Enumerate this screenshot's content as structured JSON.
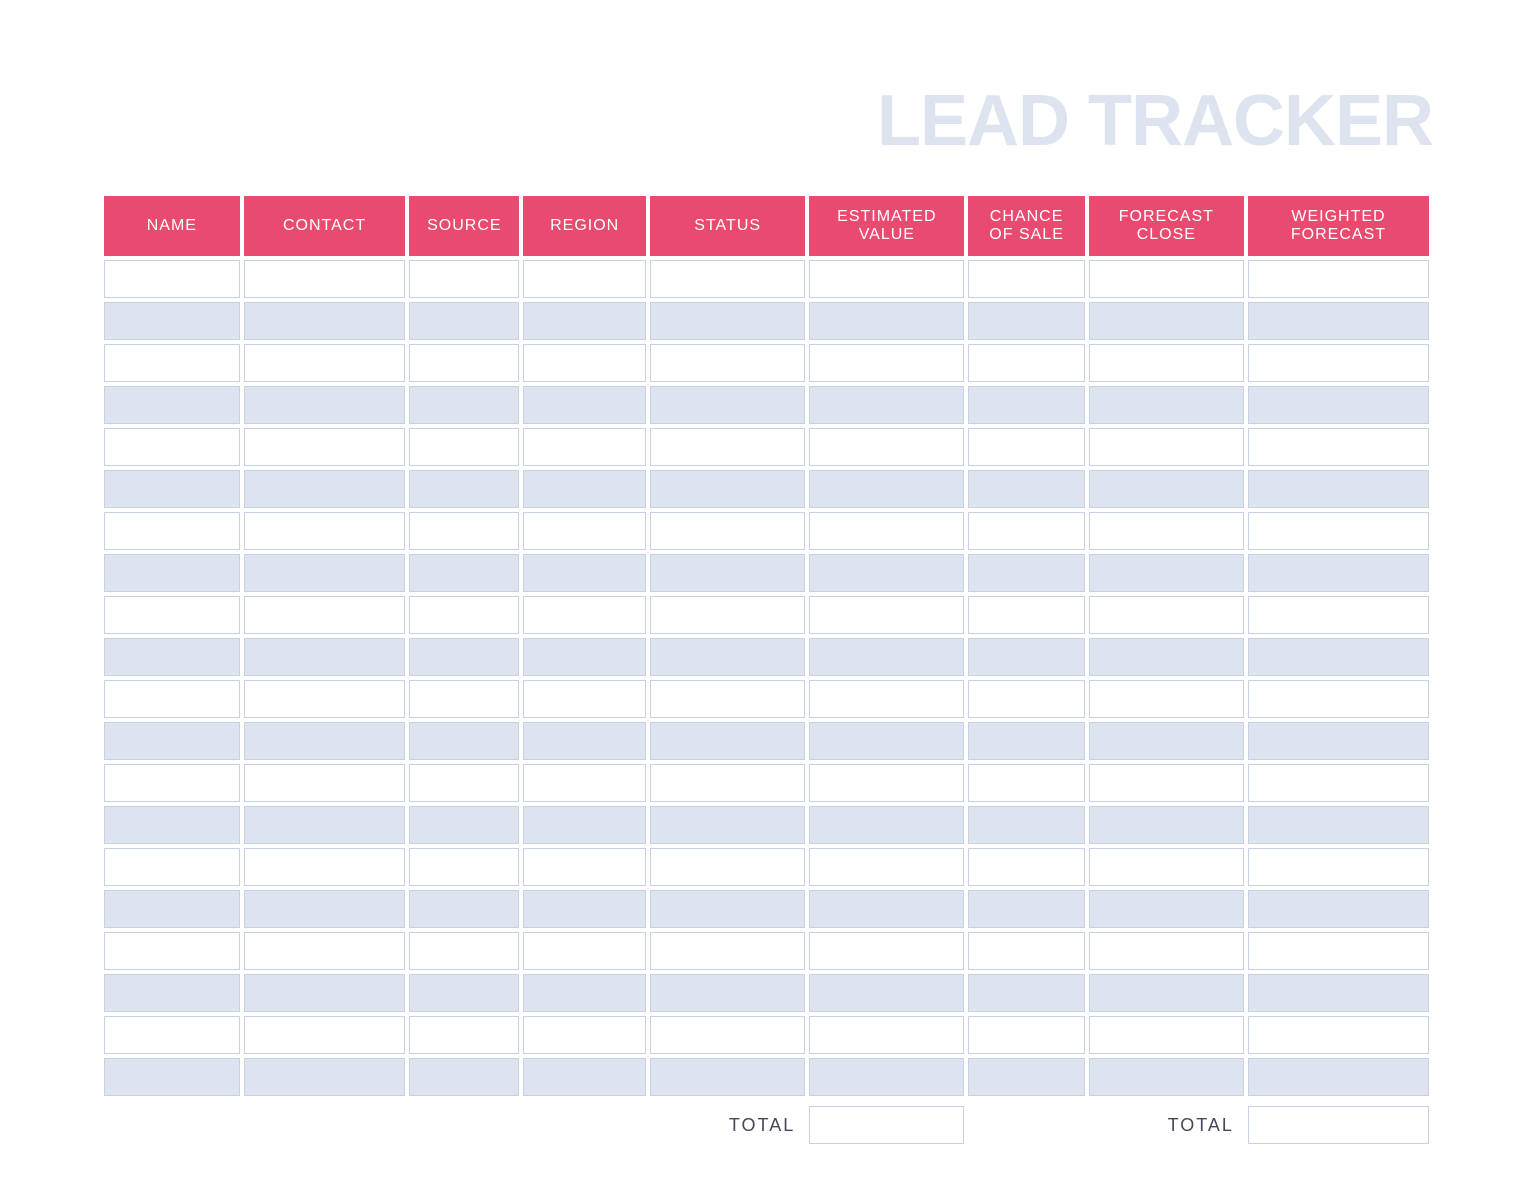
{
  "title": "LEAD TRACKER",
  "columns": [
    {
      "label": "NAME"
    },
    {
      "label": "CONTACT"
    },
    {
      "label": "SOURCE"
    },
    {
      "label": "REGION"
    },
    {
      "label": "STATUS"
    },
    {
      "label": "ESTIMATED\nVALUE"
    },
    {
      "label": "CHANCE\nOF SALE"
    },
    {
      "label": "FORECAST\nCLOSE"
    },
    {
      "label": "WEIGHTED\nFORECAST"
    }
  ],
  "rows": [
    [
      "",
      "",
      "",
      "",
      "",
      "",
      "",
      "",
      ""
    ],
    [
      "",
      "",
      "",
      "",
      "",
      "",
      "",
      "",
      ""
    ],
    [
      "",
      "",
      "",
      "",
      "",
      "",
      "",
      "",
      ""
    ],
    [
      "",
      "",
      "",
      "",
      "",
      "",
      "",
      "",
      ""
    ],
    [
      "",
      "",
      "",
      "",
      "",
      "",
      "",
      "",
      ""
    ],
    [
      "",
      "",
      "",
      "",
      "",
      "",
      "",
      "",
      ""
    ],
    [
      "",
      "",
      "",
      "",
      "",
      "",
      "",
      "",
      ""
    ],
    [
      "",
      "",
      "",
      "",
      "",
      "",
      "",
      "",
      ""
    ],
    [
      "",
      "",
      "",
      "",
      "",
      "",
      "",
      "",
      ""
    ],
    [
      "",
      "",
      "",
      "",
      "",
      "",
      "",
      "",
      ""
    ],
    [
      "",
      "",
      "",
      "",
      "",
      "",
      "",
      "",
      ""
    ],
    [
      "",
      "",
      "",
      "",
      "",
      "",
      "",
      "",
      ""
    ],
    [
      "",
      "",
      "",
      "",
      "",
      "",
      "",
      "",
      ""
    ],
    [
      "",
      "",
      "",
      "",
      "",
      "",
      "",
      "",
      ""
    ],
    [
      "",
      "",
      "",
      "",
      "",
      "",
      "",
      "",
      ""
    ],
    [
      "",
      "",
      "",
      "",
      "",
      "",
      "",
      "",
      ""
    ],
    [
      "",
      "",
      "",
      "",
      "",
      "",
      "",
      "",
      ""
    ],
    [
      "",
      "",
      "",
      "",
      "",
      "",
      "",
      "",
      ""
    ],
    [
      "",
      "",
      "",
      "",
      "",
      "",
      "",
      "",
      ""
    ],
    [
      "",
      "",
      "",
      "",
      "",
      "",
      "",
      "",
      ""
    ]
  ],
  "totals": {
    "label_estimated": "TOTAL",
    "value_estimated": "",
    "label_weighted": "TOTAL",
    "value_weighted": ""
  },
  "colors": {
    "accent": "#e94a6f",
    "tint": "#dde3ef",
    "border": "#c7d0e4"
  }
}
